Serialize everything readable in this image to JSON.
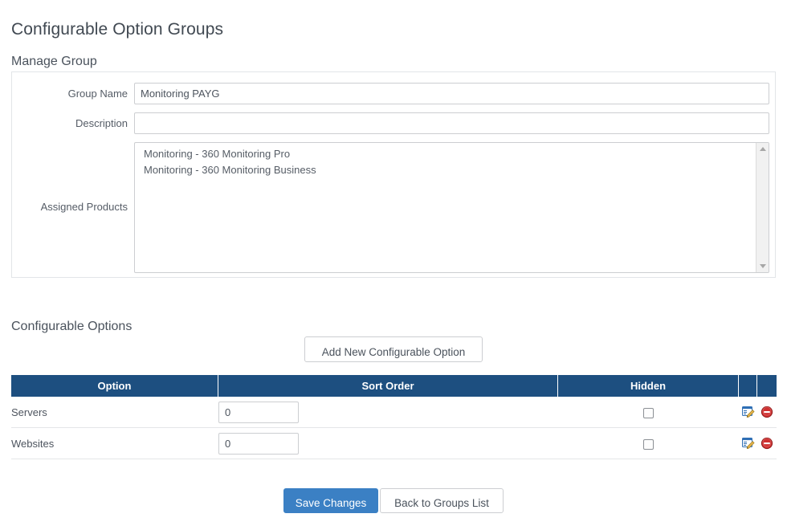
{
  "page": {
    "title": "Configurable Option Groups"
  },
  "manage_group": {
    "section_title": "Manage Group",
    "fields": {
      "group_name": {
        "label": "Group Name",
        "value": "Monitoring PAYG",
        "placeholder": ""
      },
      "description": {
        "label": "Description",
        "value": "",
        "placeholder": ""
      },
      "assigned_products": {
        "label": "Assigned Products",
        "options": [
          "Monitoring - 360 Monitoring Pro",
          "Monitoring - 360 Monitoring Business"
        ]
      }
    }
  },
  "configurable_options": {
    "section_title": "Configurable Options",
    "add_button_label": "Add New Configurable Option",
    "columns": [
      "Option",
      "Sort Order",
      "Hidden",
      "",
      ""
    ],
    "rows": [
      {
        "option": "Servers",
        "sort_order": "0",
        "hidden": false,
        "edit_icon": "edit-document-pencil-icon",
        "delete_icon": "delete-circle-icon"
      },
      {
        "option": "Websites",
        "sort_order": "0",
        "hidden": false,
        "edit_icon": "edit-document-pencil-icon",
        "delete_icon": "delete-circle-icon"
      }
    ]
  },
  "footer": {
    "save_label": "Save Changes",
    "back_label": "Back to Groups List"
  },
  "colors": {
    "table_header_bg": "#1d4f80",
    "primary_button_bg": "#3b80c4",
    "text": "#414952",
    "border": "#ccced1",
    "delete_icon": "#cf3131",
    "edit_icon_paper": "#2f6fb5",
    "edit_icon_pencil": "#e8b54a"
  }
}
